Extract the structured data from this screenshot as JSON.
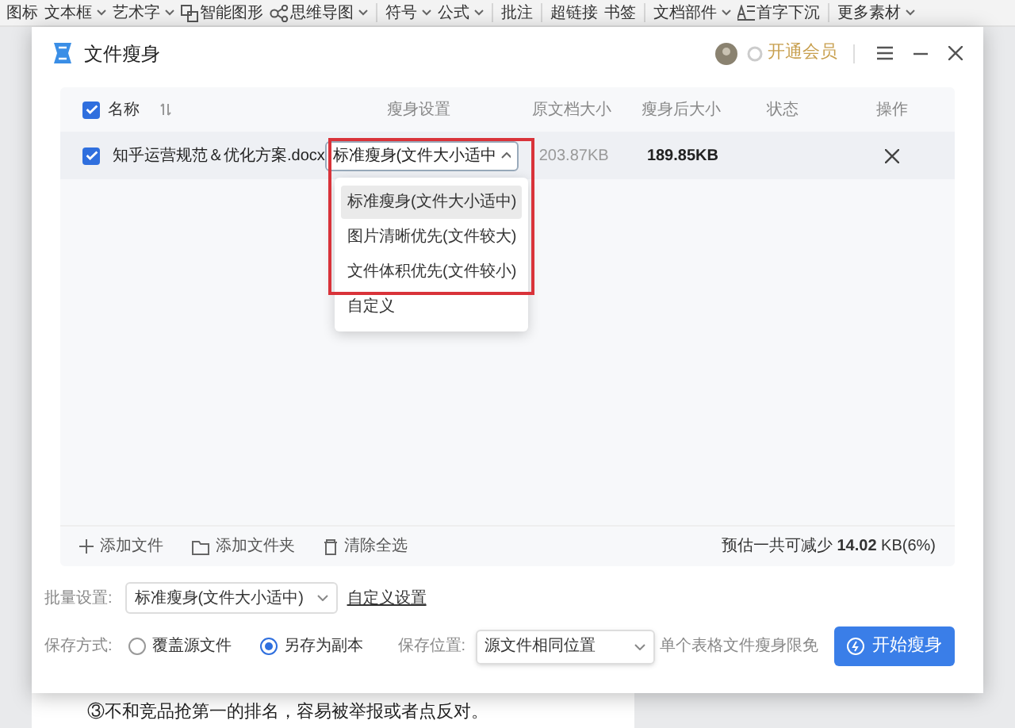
{
  "toolbar": [
    {
      "items": [
        {
          "label": "图标",
          "dropdown": false
        },
        {
          "label": "文本框",
          "dropdown": true
        },
        {
          "label": "艺术字",
          "dropdown": true
        },
        {
          "label": "智能图形",
          "dropdown": false,
          "kind": "shapes"
        },
        {
          "label": "思维导图",
          "dropdown": true,
          "kind": "mindmap"
        }
      ]
    },
    {
      "items": [
        {
          "label": "符号",
          "dropdown": true
        },
        {
          "label": "公式",
          "dropdown": true
        }
      ]
    },
    {
      "items": [
        {
          "label": "批注",
          "dropdown": false
        }
      ]
    },
    {
      "items": [
        {
          "label": "超链接",
          "dropdown": false
        },
        {
          "label": "书签",
          "dropdown": false
        }
      ]
    },
    {
      "items": [
        {
          "label": "文档部件",
          "dropdown": true
        },
        {
          "label": "首字下沉",
          "dropdown": false,
          "kind": "dropcap"
        }
      ]
    },
    {
      "items": [
        {
          "label": "更多素材",
          "dropdown": true
        }
      ]
    }
  ],
  "dialog": {
    "title": "文件瘦身",
    "member_link": "开通会员"
  },
  "table": {
    "select_all_checked": true,
    "columns": [
      "名称",
      "瘦身设置",
      "原文档大小",
      "瘦身后大小",
      "状态",
      "操作"
    ],
    "rows": [
      {
        "checked": true,
        "file_name": "知乎运营规范＆优化方案.docx",
        "setting": "标准瘦身(文件大小适中",
        "original_size": "203.87KB",
        "new_size": "189.85KB"
      }
    ]
  },
  "dropdown_menu": {
    "options": [
      {
        "label": "标准瘦身(文件大小适中)",
        "selected": true
      },
      {
        "label": "图片清晰优先(文件较大)",
        "selected": false
      },
      {
        "label": "文件体积优先(文件较小)",
        "selected": false
      },
      {
        "label": "自定义",
        "selected": false
      }
    ]
  },
  "table_footer": {
    "actions": [
      "添加文件",
      "添加文件夹",
      "清除全选"
    ],
    "estimate_prefix": "预估一共可减少",
    "estimate_value": "14.02",
    "estimate_suffix": "KB(6%)"
  },
  "batch": {
    "label": "批量设置:",
    "value": "标准瘦身(文件大小适中)",
    "custom_link": "自定义设置"
  },
  "save": {
    "label": "保存方式:",
    "options": [
      {
        "label": "覆盖源文件",
        "selected": false
      },
      {
        "label": "另存为副本",
        "selected": true
      }
    ],
    "location_label": "保存位置:",
    "location_value": "源文件相同位置",
    "limit_note": "单个表格文件瘦身限免",
    "start_button": "开始瘦身"
  },
  "document": {
    "text": "③不和竞品抢第一的排名，容易被举报或者点反对。"
  }
}
